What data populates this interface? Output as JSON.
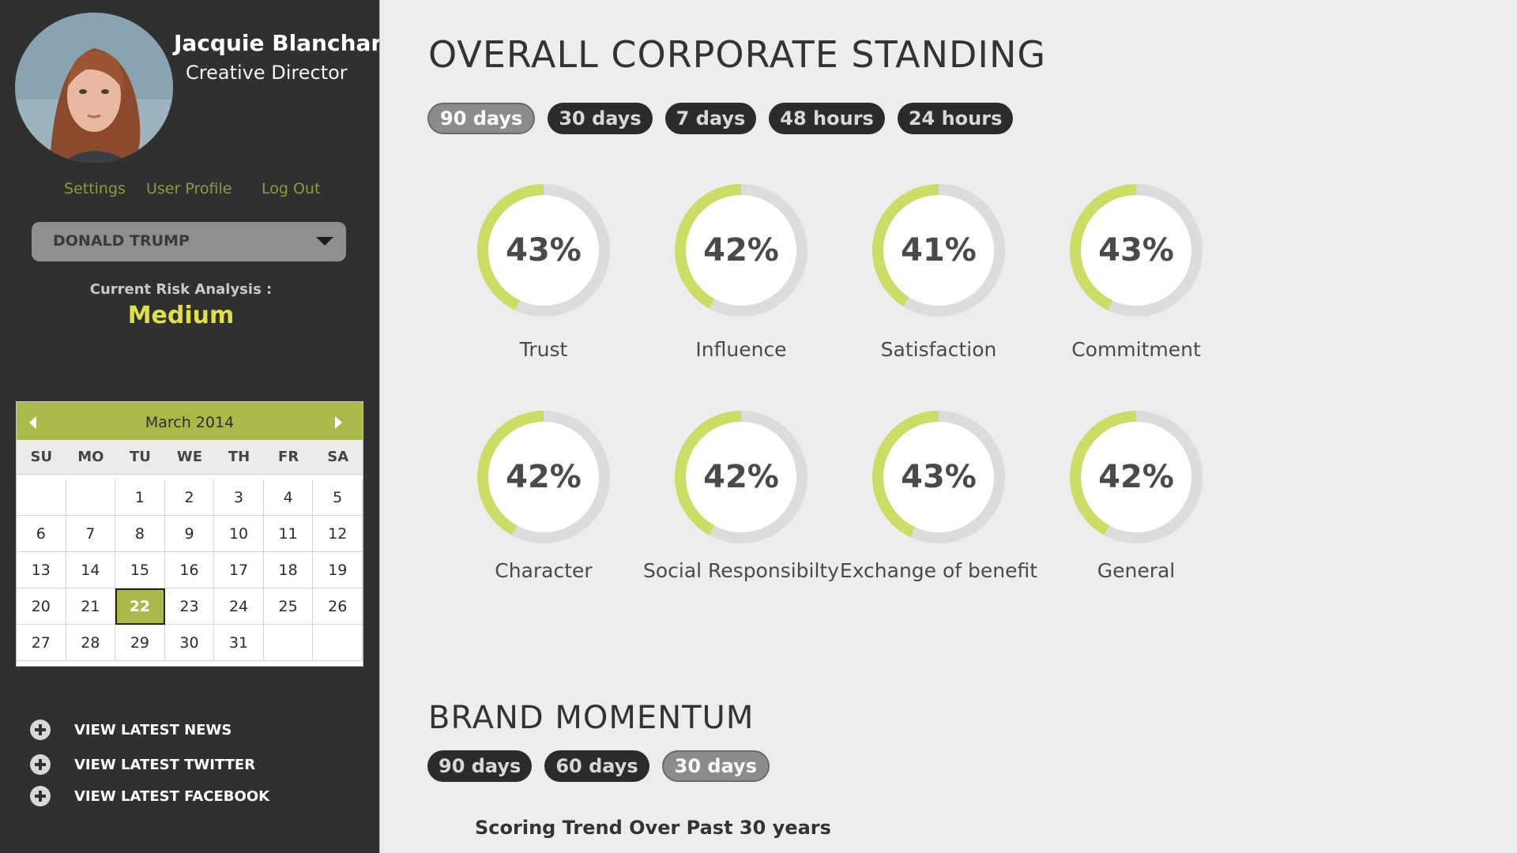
{
  "user": {
    "name": "Jacquie Blanchard",
    "role": "Creative Director",
    "links": {
      "settings": "Settings",
      "profile": "User Profile",
      "logout": "Log Out"
    }
  },
  "client_select": {
    "value": "DONALD TRUMP"
  },
  "risk": {
    "label": "Current Risk Analysis :",
    "value": "Medium"
  },
  "calendar": {
    "month": "March 2014",
    "weekdays": [
      "SU",
      "MO",
      "TU",
      "WE",
      "TH",
      "FR",
      "SA"
    ],
    "selected_day": 22,
    "days": [
      "",
      "",
      "1",
      "2",
      "3",
      "4",
      "5",
      "6",
      "7",
      "8",
      "9",
      "10",
      "11",
      "12",
      "13",
      "14",
      "15",
      "16",
      "17",
      "18",
      "19",
      "20",
      "21",
      "22",
      "23",
      "24",
      "25",
      "26",
      "27",
      "28",
      "29",
      "30",
      "31",
      "",
      ""
    ]
  },
  "feeds": [
    {
      "label": "VIEW LATEST NEWS"
    },
    {
      "label": "VIEW LATEST TWITTER"
    },
    {
      "label": "VIEW LATEST FACEBOOK"
    }
  ],
  "standing": {
    "title": "OVERALL CORPORATE STANDING",
    "pills": [
      {
        "label": "90 days",
        "active": true
      },
      {
        "label": "30 days",
        "active": false
      },
      {
        "label": "7 days",
        "active": false
      },
      {
        "label": "48 hours",
        "active": false
      },
      {
        "label": "24 hours",
        "active": false
      }
    ],
    "metrics": [
      {
        "label": "Trust",
        "value": 43
      },
      {
        "label": "Influence",
        "value": 42
      },
      {
        "label": "Satisfaction",
        "value": 41
      },
      {
        "label": "Commitment",
        "value": 43
      },
      {
        "label": "Character",
        "value": 42
      },
      {
        "label": "Social Responsibilty",
        "value": 42
      },
      {
        "label": "Exchange of benefit",
        "value": 43
      },
      {
        "label": "General",
        "value": 42
      }
    ]
  },
  "momentum": {
    "title": "BRAND MOMENTUM",
    "pills": [
      {
        "label": "90 days",
        "active": false
      },
      {
        "label": "60 days",
        "active": false
      },
      {
        "label": "30 days",
        "active": true
      }
    ],
    "trend_title": "Scoring Trend Over Past 30 years"
  },
  "colors": {
    "accent": "#ccdc64",
    "track": "#dcdcdc",
    "sidebar": "#2f3130",
    "calendar_header": "#aab94a",
    "risk": "#dfe04a"
  }
}
